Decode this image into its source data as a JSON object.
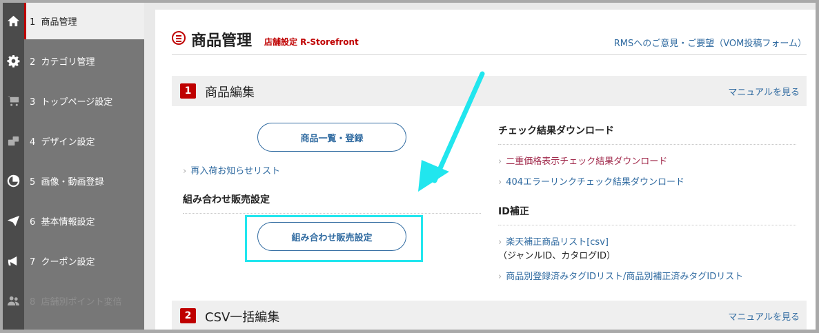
{
  "sidebar": {
    "items": [
      {
        "num": "1",
        "label": "商品管理",
        "icon": "home-icon",
        "state": "active"
      },
      {
        "num": "2",
        "label": "カテゴリ管理",
        "icon": "gear-icon",
        "state": "normal"
      },
      {
        "num": "3",
        "label": "トップページ設定",
        "icon": "cart-icon",
        "state": "normal"
      },
      {
        "num": "4",
        "label": "デザイン設定",
        "icon": "design-icon",
        "state": "normal"
      },
      {
        "num": "5",
        "label": "画像・動画登録",
        "icon": "pie-icon",
        "state": "normal"
      },
      {
        "num": "6",
        "label": "基本情報設定",
        "icon": "paper-plane-icon",
        "state": "normal"
      },
      {
        "num": "7",
        "label": "クーポン設定",
        "icon": "megaphone-icon",
        "state": "normal"
      },
      {
        "num": "8",
        "label": "店舗別ポイント変倍",
        "icon": "users-icon",
        "state": "disabled"
      }
    ]
  },
  "page": {
    "title": "商品管理",
    "subtitle": "店舗設定 R-Storefront",
    "feedback_link": "RMSへのご意見・ご要望（VOM投稿フォーム）"
  },
  "sections": [
    {
      "num": "1",
      "title": "商品編集",
      "manual": "マニュアルを見る"
    },
    {
      "num": "2",
      "title": "CSV一括編集",
      "manual": "マニュアルを見る"
    }
  ],
  "left_col": {
    "list_button": "商品一覧・登録",
    "restock_link": "再入荷お知らせリスト",
    "combo_heading": "組み合わせ販売設定",
    "combo_button": "組み合わせ販売設定"
  },
  "right_col": {
    "check_heading": "チェック結果ダウンロード",
    "check_links": [
      "二重価格表示チェック結果ダウンロード",
      "404エラーリンクチェック結果ダウンロード"
    ],
    "id_heading": "ID補正",
    "id_link_1": "楽天補正商品リスト[csv]",
    "id_note": "（ジャンルID、カタログID）",
    "id_link_2": "商品別登録済みタグIDリスト/商品別補正済みタグIDリスト"
  },
  "colors": {
    "accent": "#bf0000",
    "link": "#2f6aa0",
    "annotation": "#21e6ee"
  }
}
